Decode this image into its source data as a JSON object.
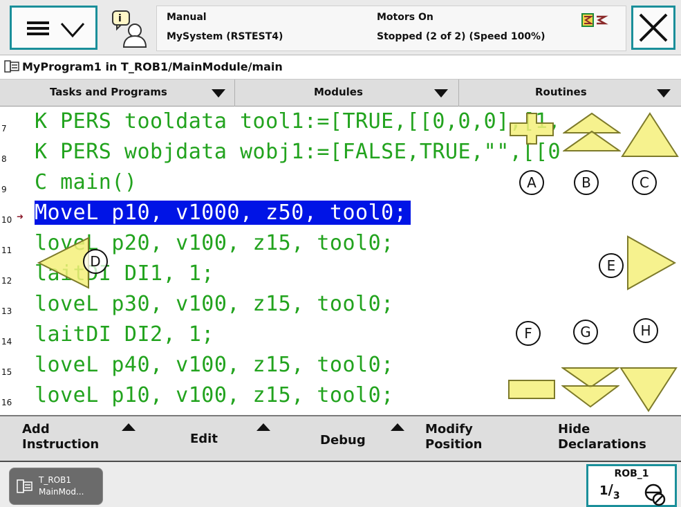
{
  "header": {
    "mode": "Manual",
    "system": "MySystem (RSTEST4)",
    "motors": "Motors On",
    "run_state": "Stopped (2 of 2) (Speed 100%)"
  },
  "program_path": "MyProgram1 in T_ROB1/MainModule/main",
  "tabs": [
    {
      "label": "Tasks and Programs"
    },
    {
      "label": "Modules"
    },
    {
      "label": "Routines"
    }
  ],
  "code": {
    "lines": [
      {
        "num": "7",
        "text": "K PERS tooldata tool1:=[TRUE,[[0,0,0],[1,"
      },
      {
        "num": "8",
        "text": "K PERS wobjdata wobj1:=[FALSE,TRUE,\"\",[[0"
      },
      {
        "num": "9",
        "text": "C main()"
      },
      {
        "num": "10",
        "text": "MoveL p10, v1000, z50, tool0;"
      },
      {
        "num": "11",
        "text": "loveL p20, v100, z15, tool0;"
      },
      {
        "num": "12",
        "text": "laitDI DI1, 1;"
      },
      {
        "num": "13",
        "text": "loveL p30, v100, z15, tool0;"
      },
      {
        "num": "14",
        "text": "laitDI DI2, 1;"
      },
      {
        "num": "15",
        "text": "loveL p40, v100, z15, tool0;"
      },
      {
        "num": "16",
        "text": "loveL p10, v100, z15, tool0;"
      }
    ],
    "selected_line": "10"
  },
  "markers": [
    "A",
    "B",
    "C",
    "D",
    "E",
    "F",
    "G",
    "H"
  ],
  "commands": [
    {
      "label": "Add\nInstruction"
    },
    {
      "label": "Edit"
    },
    {
      "label": "Debug"
    },
    {
      "label": "Modify\nPosition"
    },
    {
      "label": "Hide\nDeclarations"
    }
  ],
  "taskbar": {
    "task_line1": "T_ROB1",
    "task_line2": "MainMod...",
    "quickset_unit": "ROB_1"
  },
  "colors": {
    "code_text": "#22a31e",
    "selection": "#0014e6",
    "frame_accent": "#1a8f9a",
    "overlay_fill": "#f5f07a"
  }
}
